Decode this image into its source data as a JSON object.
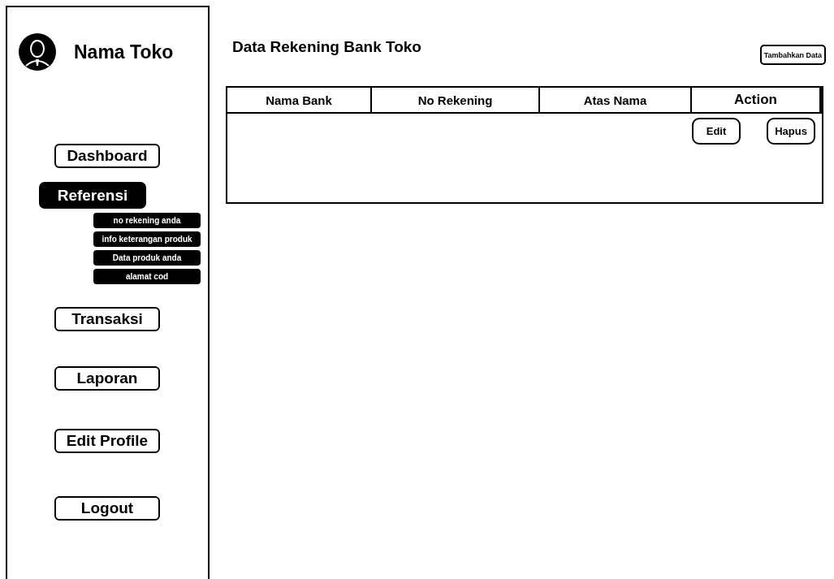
{
  "sidebar": {
    "store_name": "Nama Toko",
    "items": [
      {
        "label": "Dashboard",
        "selected": false
      },
      {
        "label": "Referensi",
        "selected": true,
        "children": [
          {
            "label": "no rekening anda"
          },
          {
            "label": "info keterangan produk"
          },
          {
            "label": "Data produk anda"
          },
          {
            "label": "alamat cod"
          }
        ]
      },
      {
        "label": "Transaksi",
        "selected": false
      },
      {
        "label": "Laporan",
        "selected": false
      },
      {
        "label": "Edit Profile",
        "selected": false
      },
      {
        "label": "Logout",
        "selected": false
      }
    ]
  },
  "main": {
    "title": "Data Rekening Bank Toko",
    "add_button": "Tambahkan Data",
    "table": {
      "columns": [
        "Nama Bank",
        "No Rekening",
        "Atas Nama",
        "Action"
      ],
      "rows": [
        {
          "actions": [
            "Edit",
            "Hapus"
          ]
        }
      ]
    }
  }
}
